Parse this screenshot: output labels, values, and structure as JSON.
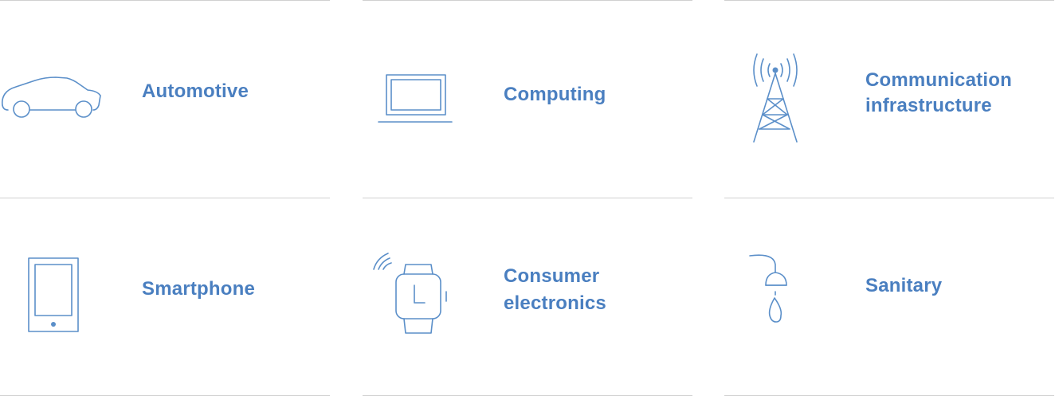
{
  "industries": [
    {
      "label": "Automotive",
      "icon": "car-icon"
    },
    {
      "label": "Computing",
      "icon": "laptop-icon"
    },
    {
      "label": "Communication infrastructure",
      "line1": "Communication",
      "line2": "infrastructure",
      "icon": "radio-tower-icon"
    },
    {
      "label": "Smartphone",
      "icon": "smartphone-icon"
    },
    {
      "label": "Consumer electronics",
      "line1": "Consumer",
      "line2": "electronics",
      "icon": "smartwatch-icon"
    },
    {
      "label": "Sanitary",
      "icon": "faucet-drop-icon"
    }
  ],
  "colors": {
    "accent": "#4a7fc0",
    "icon_stroke": "#5b8fc9",
    "divider": "#d0d0d0"
  }
}
